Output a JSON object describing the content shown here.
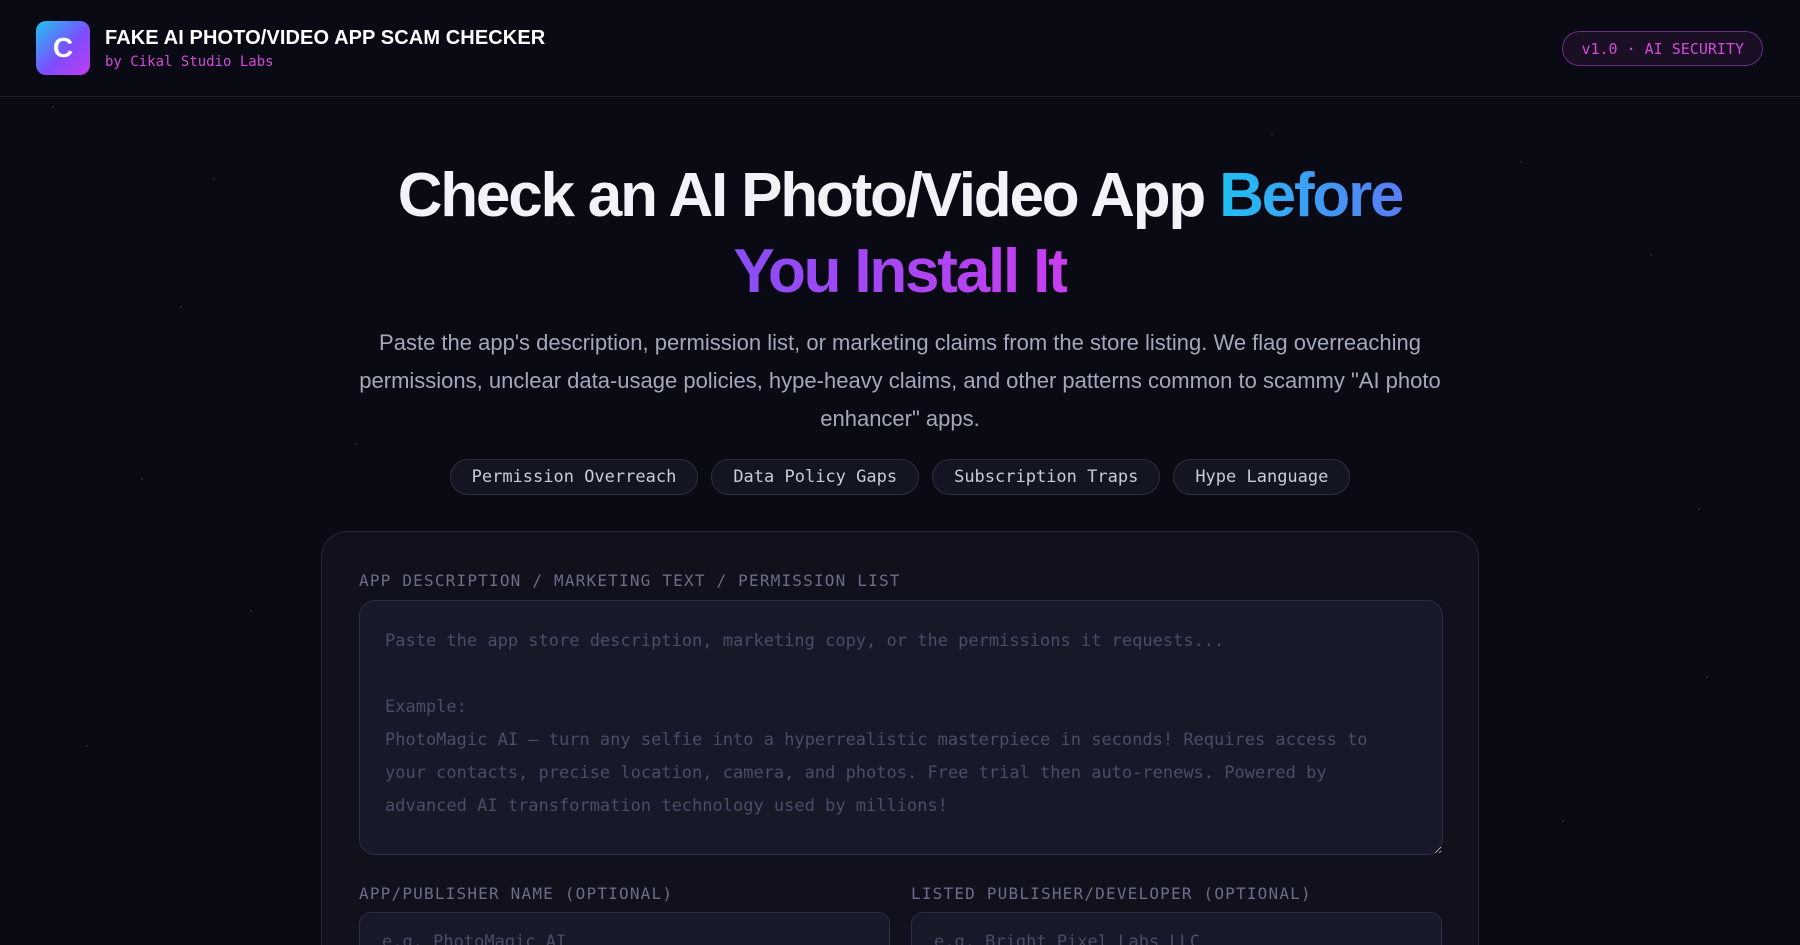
{
  "header": {
    "logo_letter": "C",
    "title": "FAKE AI PHOTO/VIDEO APP SCAM CHECKER",
    "subtitle": "by Cikal Studio Labs",
    "version_badge": "v1.0 · AI SECURITY"
  },
  "hero": {
    "title_part1": "Check an AI Photo/Video App ",
    "title_highlight1": "Before",
    "title_highlight2": "You Install It",
    "description": "Paste the app's description, permission list, or marketing claims from the store listing. We flag overreaching permissions, unclear data-usage policies, hype-heavy claims, and other patterns common to scammy \"AI photo enhancer\" apps."
  },
  "tags": [
    "Permission Overreach",
    "Data Policy Gaps",
    "Subscription Traps",
    "Hype Language"
  ],
  "form": {
    "description_label": "APP DESCRIPTION / MARKETING TEXT / PERMISSION LIST",
    "description_placeholder": "Paste the app store description, marketing copy, or the permissions it requests...\n\nExample:\nPhotoMagic AI — turn any selfie into a hyperrealistic masterpiece in seconds! Requires access to your contacts, precise location, camera, and photos. Free trial then auto-renews. Powered by advanced AI transformation technology used by millions!",
    "app_name_label": "APP/PUBLISHER NAME (OPTIONAL)",
    "app_name_placeholder": "e.g. PhotoMagic AI",
    "publisher_label": "LISTED PUBLISHER/DEVELOPER (OPTIONAL)",
    "publisher_placeholder": "e.g. Bright Pixel Labs LLC"
  },
  "colors": {
    "background": "#0a0a14",
    "accent_cyan": "#1fc0f2",
    "accent_purple": "#8a4df5",
    "accent_magenta": "#d24bd8"
  }
}
